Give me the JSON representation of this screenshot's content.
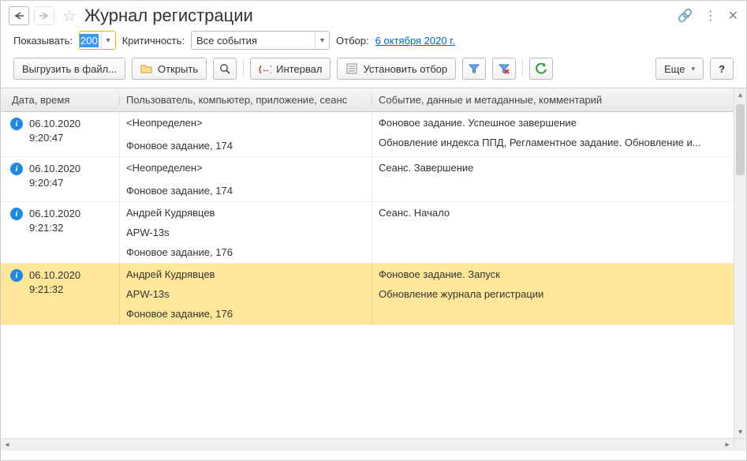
{
  "title": "Журнал регистрации",
  "filters": {
    "show_label": "Показывать:",
    "show_value": "200",
    "crit_label": "Критичность:",
    "crit_value": "Все события",
    "filter_label": "Отбор:",
    "filter_link": "6 октября 2020 г."
  },
  "toolbar": {
    "export": "Выгрузить в файл...",
    "open": "Открыть",
    "interval": "Интервал",
    "set_filter": "Установить отбор",
    "more": "Еще",
    "help": "?"
  },
  "columns": {
    "c1": "Дата, время",
    "c2": "Пользователь, компьютер, приложение, сеанс",
    "c3": "Событие, данные и метаданные, комментарий"
  },
  "rows": [
    {
      "date": "06.10.2020",
      "time": "9:20:47",
      "user": "<Неопределен>",
      "comp": "",
      "app": "Фоновое задание, 174",
      "event": "Фоновое задание. Успешное завершение",
      "detail": "Обновление индекса ППД, Регламентное задание. Обновление и...",
      "selected": false
    },
    {
      "date": "06.10.2020",
      "time": "9:20:47",
      "user": "<Неопределен>",
      "comp": "",
      "app": "Фоновое задание, 174",
      "event": "Сеанс. Завершение",
      "detail": "",
      "selected": false
    },
    {
      "date": "06.10.2020",
      "time": "9:21:32",
      "user": "Андрей Кудрявцев",
      "comp": "APW-13s",
      "app": "Фоновое задание, 176",
      "event": "Сеанс. Начало",
      "detail": "",
      "selected": false
    },
    {
      "date": "06.10.2020",
      "time": "9:21:32",
      "user": "Андрей Кудрявцев",
      "comp": "APW-13s",
      "app": "Фоновое задание, 176",
      "event": "Фоновое задание. Запуск",
      "detail": "Обновление журнала регистрации",
      "selected": true
    }
  ]
}
